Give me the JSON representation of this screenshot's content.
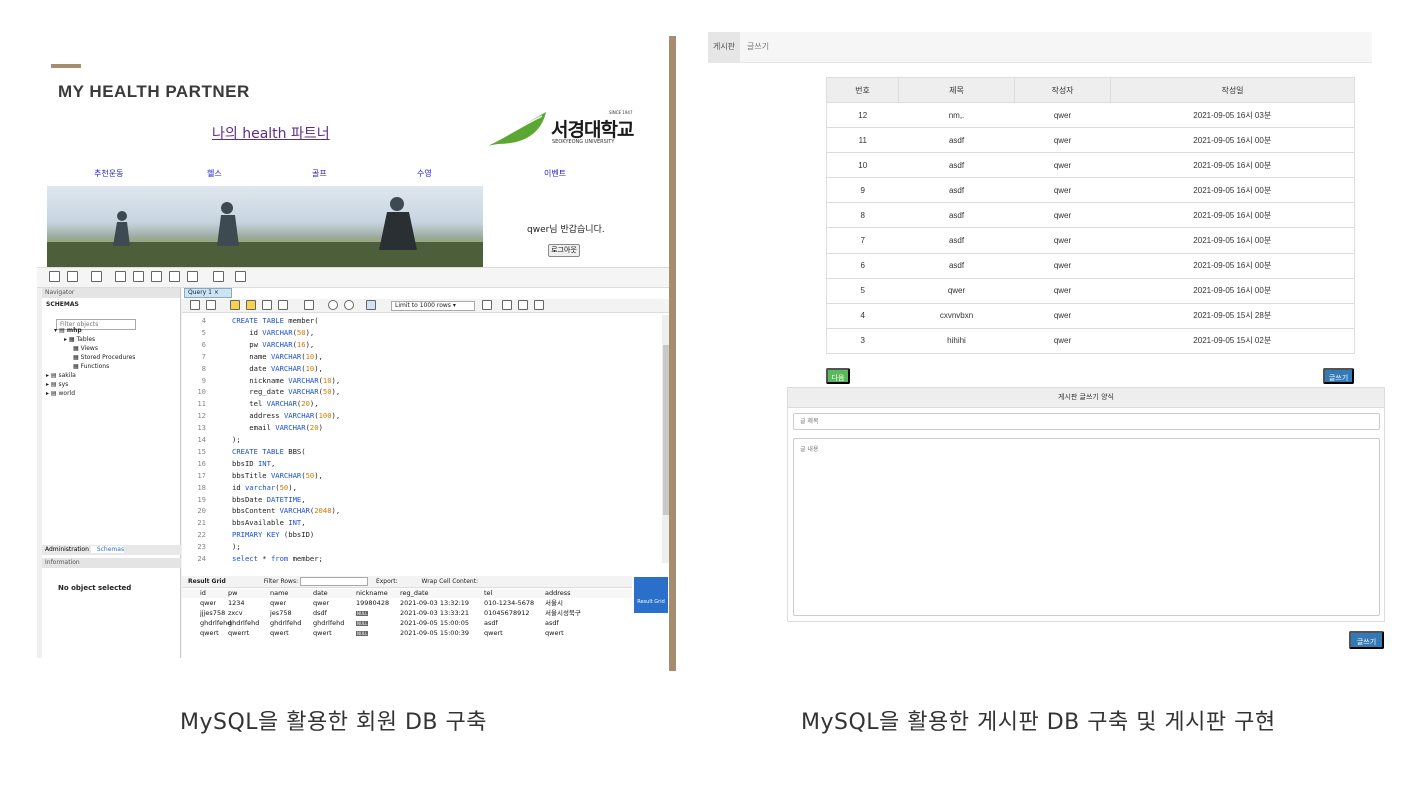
{
  "left": {
    "brand": "MY HEALTH PARTNER",
    "site_title": "나의 health 파트너",
    "logo": {
      "name": "서경대학교",
      "since": "SINCE 1947",
      "sub": "SEOKYEONG UNIVERSITY",
      "leaf_color": "#5aa832"
    },
    "site_nav": [
      "추천운동",
      "헬스",
      "골프",
      "수영",
      "이벤트"
    ],
    "welcome": "qwer님 반갑습니다.",
    "logout": "로그아웃",
    "workbench": {
      "navigator": "Navigator",
      "schemas": "SCHEMAS",
      "filter_placeholder": "Filter objects",
      "tree": [
        "mhp",
        "Tables",
        "Views",
        "Stored Procedures",
        "Functions",
        "sakila",
        "sys",
        "world"
      ],
      "tabs": [
        "Administration",
        "Schemas"
      ],
      "information": "Information",
      "no_object": "No object selected",
      "query_tab": "Query 1",
      "limit": "Limit to 1000 rows",
      "code_lines": [
        {
          "n": "4",
          "t": "CREATE TABLE member("
        },
        {
          "n": "5",
          "t": "    id VARCHAR(50),"
        },
        {
          "n": "6",
          "t": "    pw VARCHAR(16),"
        },
        {
          "n": "7",
          "t": "    name VARCHAR(10),"
        },
        {
          "n": "8",
          "t": "    date VARCHAR(10),"
        },
        {
          "n": "9",
          "t": "    nickname VARCHAR(10),"
        },
        {
          "n": "10",
          "t": "    reg_date VARCHAR(50),"
        },
        {
          "n": "11",
          "t": "    tel VARCHAR(20),"
        },
        {
          "n": "12",
          "t": "    address VARCHAR(100),"
        },
        {
          "n": "13",
          "t": "    email VARCHAR(20)"
        },
        {
          "n": "14",
          "t": ");"
        },
        {
          "n": "15",
          "t": "CREATE TABLE BBS("
        },
        {
          "n": "16",
          "t": "bbsID INT,"
        },
        {
          "n": "17",
          "t": "bbsTitle VARCHAR(50),"
        },
        {
          "n": "18",
          "t": "id varchar(50),"
        },
        {
          "n": "19",
          "t": "bbsDate DATETIME,"
        },
        {
          "n": "20",
          "t": "bbsContent VARCHAR(2048),"
        },
        {
          "n": "21",
          "t": "bbsAvailable INT,"
        },
        {
          "n": "22",
          "t": "PRIMARY KEY (bbsID)"
        },
        {
          "n": "23",
          "t": ");"
        },
        {
          "n": "24",
          "t": "select * from member;"
        }
      ],
      "result_bar": {
        "grid": "Result Grid",
        "filter": "Filter Rows:",
        "export": "Export:",
        "wrap": "Wrap Cell Content:",
        "result_grid_btn": "Result Grid"
      },
      "result_columns": [
        "id",
        "pw",
        "name",
        "date",
        "nickname",
        "reg_date",
        "tel",
        "address"
      ],
      "result_rows": [
        [
          "qwer",
          "1234",
          "qwer",
          "qwer",
          "19980428",
          "2021-09-03 13:32:19",
          "010-1234-5678",
          "서울시"
        ],
        [
          "jjjes758",
          "zxcv",
          "jes758",
          "dsdf",
          "NULL",
          "2021-09-03 13:33:21",
          "01045678912",
          "서울시성북구"
        ],
        [
          "ghdrlfehd",
          "ghdrlfehd",
          "ghdrlfehd",
          "ghdrlfehd",
          "NULL",
          "2021-09-05 15:00:05",
          "asdf",
          "asdf"
        ],
        [
          "qwert",
          "qwerrt",
          "qwert",
          "qwert",
          "NULL",
          "2021-09-05 15:00:39",
          "qwert",
          "qwert"
        ]
      ]
    },
    "caption": "MySQL을 활용한 회원 DB 구축"
  },
  "right": {
    "nav_tabs": [
      "게시판",
      "글쓰기"
    ],
    "table_headers": [
      "번호",
      "제목",
      "작성자",
      "작성일"
    ],
    "rows": [
      [
        "12",
        "nm,.",
        "qwer",
        "2021-09-05 16시 03분"
      ],
      [
        "11",
        "asdf",
        "qwer",
        "2021-09-05 16시 00분"
      ],
      [
        "10",
        "asdf",
        "qwer",
        "2021-09-05 16시 00분"
      ],
      [
        "9",
        "asdf",
        "qwer",
        "2021-09-05 16시 00분"
      ],
      [
        "8",
        "asdf",
        "qwer",
        "2021-09-05 16시 00분"
      ],
      [
        "7",
        "asdf",
        "qwer",
        "2021-09-05 16시 00분"
      ],
      [
        "6",
        "asdf",
        "qwer",
        "2021-09-05 16시 00분"
      ],
      [
        "5",
        "qwer",
        "qwer",
        "2021-09-05 16시 00분"
      ],
      [
        "4",
        "cxvnvbxn",
        "qwer",
        "2021-09-05 15시 28분"
      ],
      [
        "3",
        "hihihi",
        "qwer",
        "2021-09-05 15시 02분"
      ]
    ],
    "next_btn": "다음",
    "write_btn": "글쓰기",
    "form_title": "게시판 글쓰기 양식",
    "title_placeholder": "글 제목",
    "content_placeholder": "글 내용",
    "submit_btn": "글쓰기",
    "caption": "MySQL을 활용한 게시판 DB 구축 및 게시판 구현"
  },
  "colors": {
    "accent": "#a58d6f",
    "primary": "#337ab7",
    "success": "#5cb85c",
    "link": "#1a1ad6"
  }
}
